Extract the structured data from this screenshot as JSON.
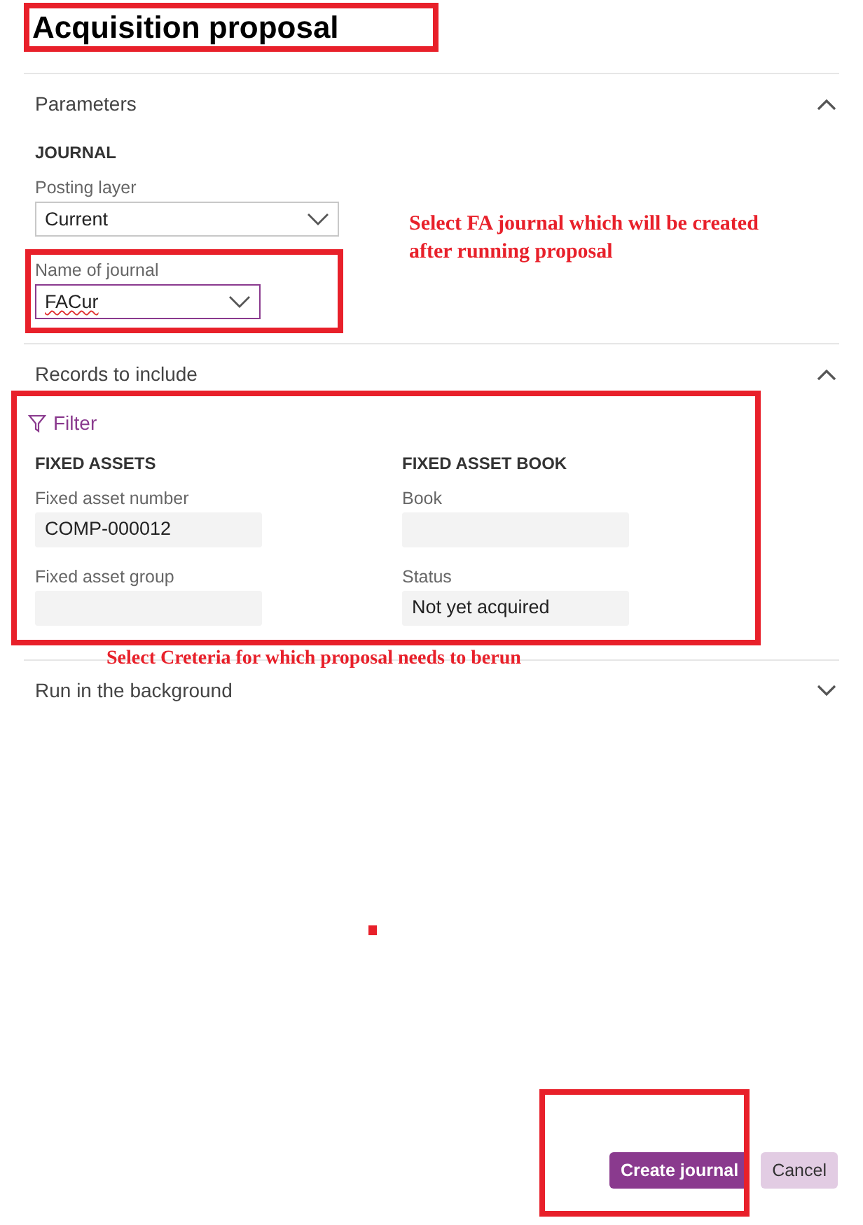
{
  "title": "Acquisition proposal",
  "sections": [
    {
      "kind": "journal",
      "title": "Parameters",
      "expanded": true,
      "group": "JOURNAL",
      "fields": [
        {
          "label": "Posting layer",
          "value": "Current",
          "kind": "select",
          "focused": false
        },
        {
          "label": "Name of journal",
          "value": "FACur",
          "kind": "select",
          "focused": true
        }
      ]
    },
    {
      "kind": "records",
      "title": "Records to include",
      "expanded": true,
      "filter": "Filter",
      "columns": [
        {
          "group": "FIXED ASSETS",
          "fields": [
            {
              "label": "Fixed asset number",
              "value": "COMP-000012"
            },
            {
              "label": "Fixed asset group"
            }
          ]
        },
        {
          "group": "FIXED ASSET BOOK",
          "fields": [
            {
              "label": "Book"
            },
            {
              "label": "Status",
              "value": "Not yet acquired"
            }
          ]
        }
      ]
    },
    {
      "kind": "background",
      "title": "Run in the background",
      "expanded": false
    }
  ],
  "buttons": [
    {
      "label": "Create journal",
      "primary": true
    },
    {
      "label": "Cancel",
      "primary": false
    }
  ],
  "annotations": [
    {
      "text": "Select FA journal which will be created after running proposal"
    },
    {
      "text": "Select Creteria for which proposal needs to berun"
    }
  ]
}
